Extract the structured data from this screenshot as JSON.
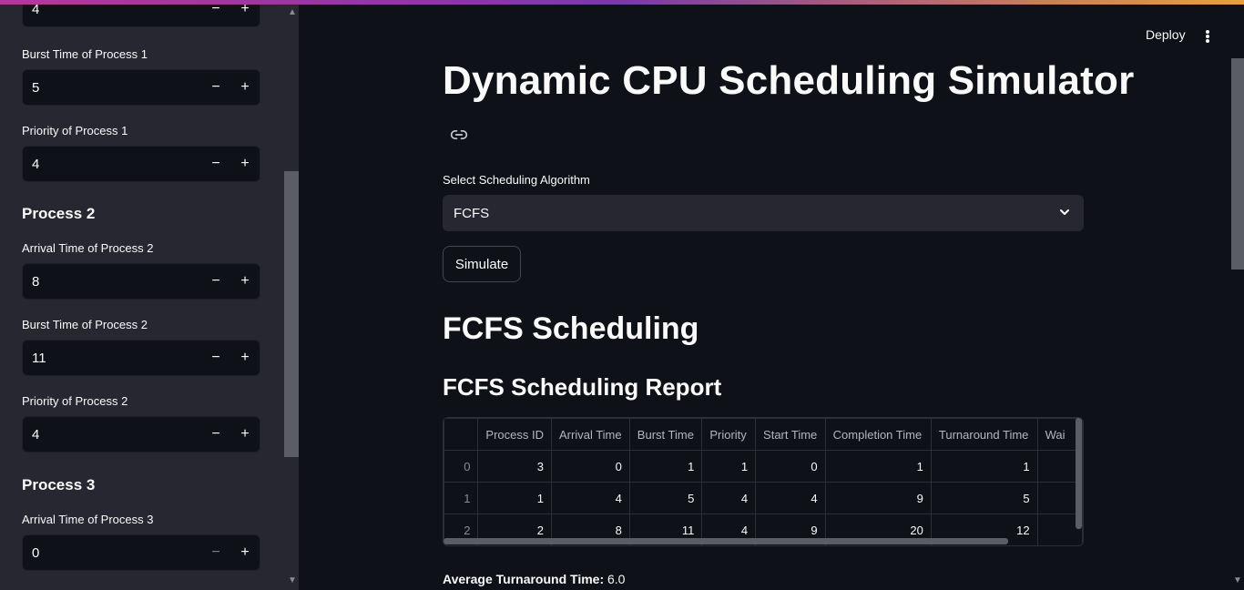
{
  "sidebar": {
    "fields": [
      {
        "label": "",
        "value": "4"
      },
      {
        "label": "Burst Time of Process 1",
        "value": "5"
      },
      {
        "label": "Priority of Process 1",
        "value": "4"
      },
      {
        "label": "Arrival Time of Process 2",
        "value": "8"
      },
      {
        "label": "Burst Time of Process 2",
        "value": "11"
      },
      {
        "label": "Priority of Process 2",
        "value": "4"
      },
      {
        "label": "Arrival Time of Process 3",
        "value": "0"
      }
    ],
    "headings": [
      "Process 2",
      "Process 3"
    ],
    "minus": "−",
    "plus": "+"
  },
  "header": {
    "deploy": "Deploy"
  },
  "main": {
    "title": "Dynamic CPU Scheduling Simulator",
    "select_label": "Select Scheduling Algorithm",
    "select_value": "FCFS",
    "simulate": "Simulate",
    "section_title": "FCFS Scheduling",
    "report_title": "FCFS Scheduling Report",
    "table": {
      "columns": [
        "",
        "Process ID",
        "Arrival Time",
        "Burst Time",
        "Priority",
        "Start Time",
        "Completion Time",
        "Turnaround Time",
        "Wai"
      ],
      "rows": [
        [
          "0",
          "3",
          "0",
          "1",
          "1",
          "0",
          "1",
          "1"
        ],
        [
          "1",
          "1",
          "4",
          "5",
          "4",
          "4",
          "9",
          "5"
        ],
        [
          "2",
          "2",
          "8",
          "11",
          "4",
          "9",
          "20",
          "12"
        ]
      ]
    },
    "avg_label": "Average Turnaround Time:",
    "avg_value": "6.0"
  }
}
